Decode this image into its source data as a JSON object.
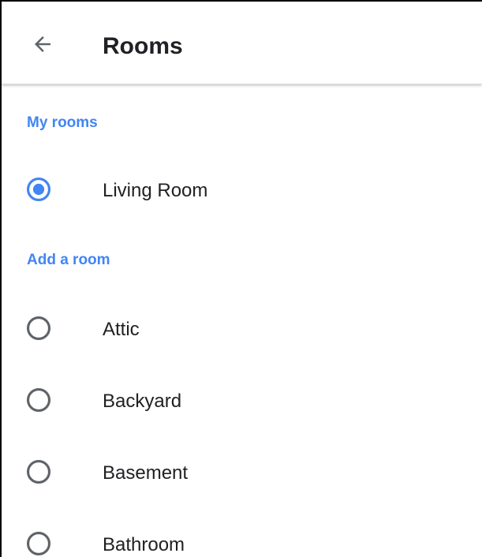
{
  "header": {
    "title": "Rooms",
    "back_icon": "arrow-left-icon"
  },
  "colors": {
    "accent": "#4285f4",
    "text": "#202124",
    "radio_unselected": "#5f6368"
  },
  "sections": {
    "my_rooms": {
      "title": "My rooms",
      "items": [
        {
          "label": "Living Room",
          "selected": true
        }
      ]
    },
    "add_room": {
      "title": "Add a room",
      "items": [
        {
          "label": "Attic",
          "selected": false
        },
        {
          "label": "Backyard",
          "selected": false
        },
        {
          "label": "Basement",
          "selected": false
        },
        {
          "label": "Bathroom",
          "selected": false
        }
      ]
    }
  }
}
